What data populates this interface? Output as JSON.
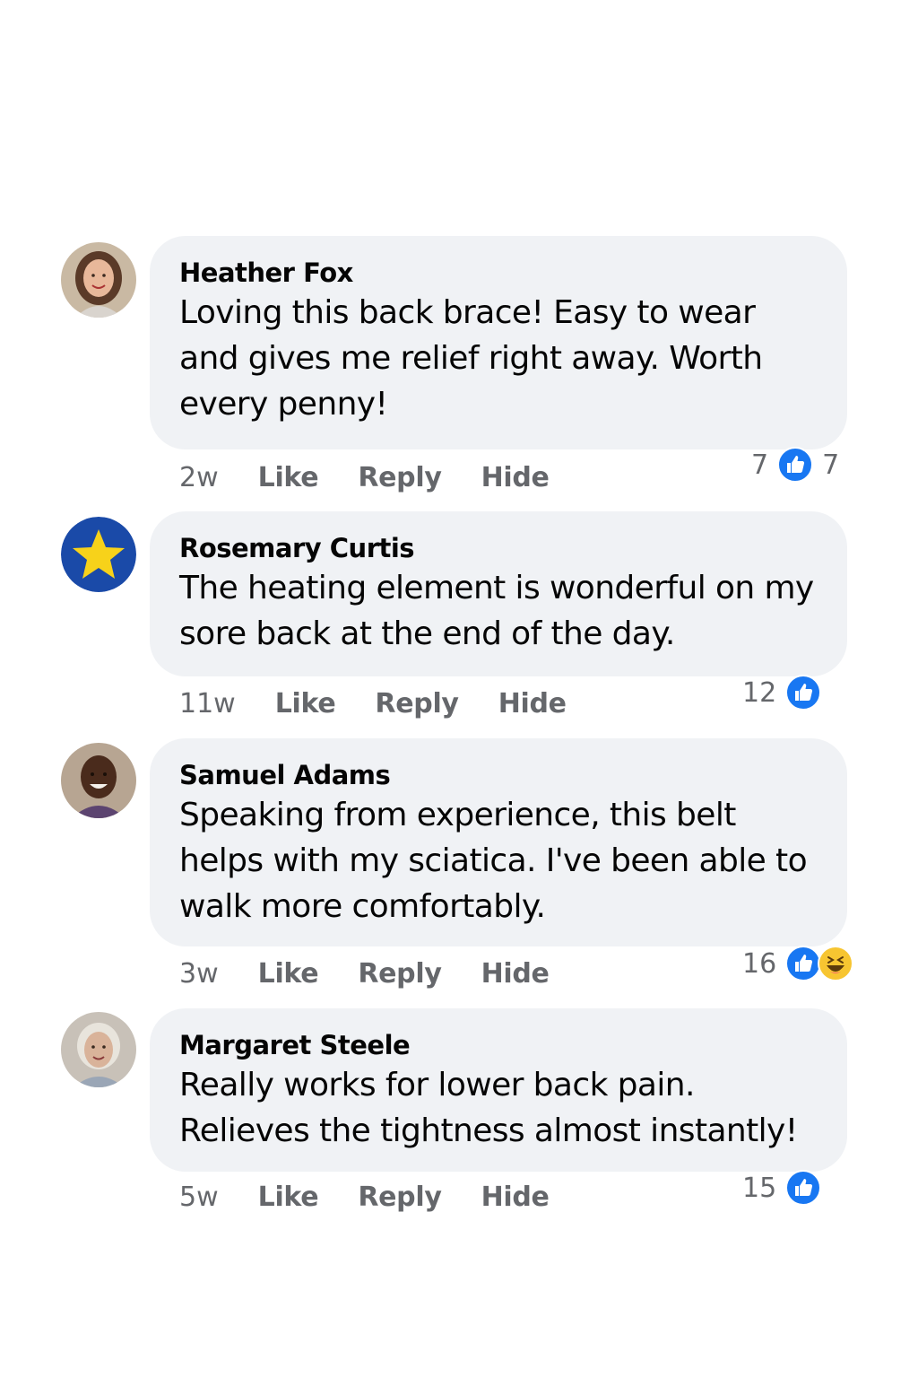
{
  "comments": [
    {
      "author": "Heather Fox",
      "text": "Loving this back brace! Easy to wear and gives me relief right away. Worth every penny!",
      "time": "2w",
      "actions": {
        "like": "Like",
        "reply": "Reply",
        "hide": "Hide"
      },
      "reaction_count": "7",
      "reaction_count_after": "7",
      "reactions": [
        "like-icon"
      ],
      "avatar": "photo-woman-brown-hair"
    },
    {
      "author": "Rosemary Curtis",
      "text": "The heating element is wonderful on my sore back at the end of the day.",
      "time": "11w",
      "actions": {
        "like": "Like",
        "reply": "Reply",
        "hide": "Hide"
      },
      "reaction_count": "12",
      "reactions": [
        "like-icon"
      ],
      "avatar": "star-icon"
    },
    {
      "author": "Samuel Adams",
      "text": "Speaking from experience, this belt helps with my sciatica. I've been able to walk more comfortably.",
      "time": "3w",
      "actions": {
        "like": "Like",
        "reply": "Reply",
        "hide": "Hide"
      },
      "reaction_count": "16",
      "reactions": [
        "like-icon",
        "haha-icon"
      ],
      "avatar": "photo-man-smiling"
    },
    {
      "author": "Margaret Steele",
      "text": "Really works for lower back pain. Relieves the tightness almost instantly!",
      "time": "5w",
      "actions": {
        "like": "Like",
        "reply": "Reply",
        "hide": "Hide"
      },
      "reaction_count": "15",
      "reactions": [
        "like-icon"
      ],
      "avatar": "photo-older-woman"
    }
  ],
  "colors": {
    "bubble": "#f0f2f5",
    "text": "#050505",
    "meta": "#65676b",
    "like_blue": "#1877f2",
    "star_bg": "#1a4aa8",
    "star": "#f7d21a",
    "haha": "#f7c531"
  }
}
